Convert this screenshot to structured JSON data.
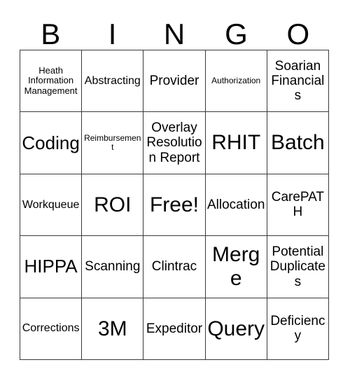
{
  "card": {
    "header_letters": [
      "B",
      "I",
      "N",
      "G",
      "O"
    ],
    "rows": [
      [
        {
          "text": "Heath Information Management",
          "size": "xs"
        },
        {
          "text": "Abstracting",
          "size": "sm"
        },
        {
          "text": "Provider",
          "size": "md"
        },
        {
          "text": "Authorization",
          "size": "xxs"
        },
        {
          "text": "Soarian Financials",
          "size": "md"
        }
      ],
      [
        {
          "text": "Coding",
          "size": "lg"
        },
        {
          "text": "Reimbursement",
          "size": "xxs"
        },
        {
          "text": "Overlay Resolution Report",
          "size": "md"
        },
        {
          "text": "RHIT",
          "size": "xl"
        },
        {
          "text": "Batch",
          "size": "xl"
        }
      ],
      [
        {
          "text": "Workqueue",
          "size": "sm"
        },
        {
          "text": "ROI",
          "size": "xl"
        },
        {
          "text": "Free!",
          "size": "xl"
        },
        {
          "text": "Allocation",
          "size": "md"
        },
        {
          "text": "CarePATH",
          "size": "md"
        }
      ],
      [
        {
          "text": "HIPPA",
          "size": "lg"
        },
        {
          "text": "Scanning",
          "size": "md"
        },
        {
          "text": "Clintrac",
          "size": "md"
        },
        {
          "text": "Merge",
          "size": "xl"
        },
        {
          "text": "Potential Duplicates",
          "size": "md"
        }
      ],
      [
        {
          "text": "Corrections",
          "size": "sm"
        },
        {
          "text": "3M",
          "size": "xl"
        },
        {
          "text": "Expeditor",
          "size": "md"
        },
        {
          "text": "Query",
          "size": "xl"
        },
        {
          "text": "Deficiency",
          "size": "md"
        }
      ]
    ]
  },
  "colors": {
    "background": "#ffffff",
    "text": "#000000",
    "grid_line": "#3a3a3a"
  }
}
